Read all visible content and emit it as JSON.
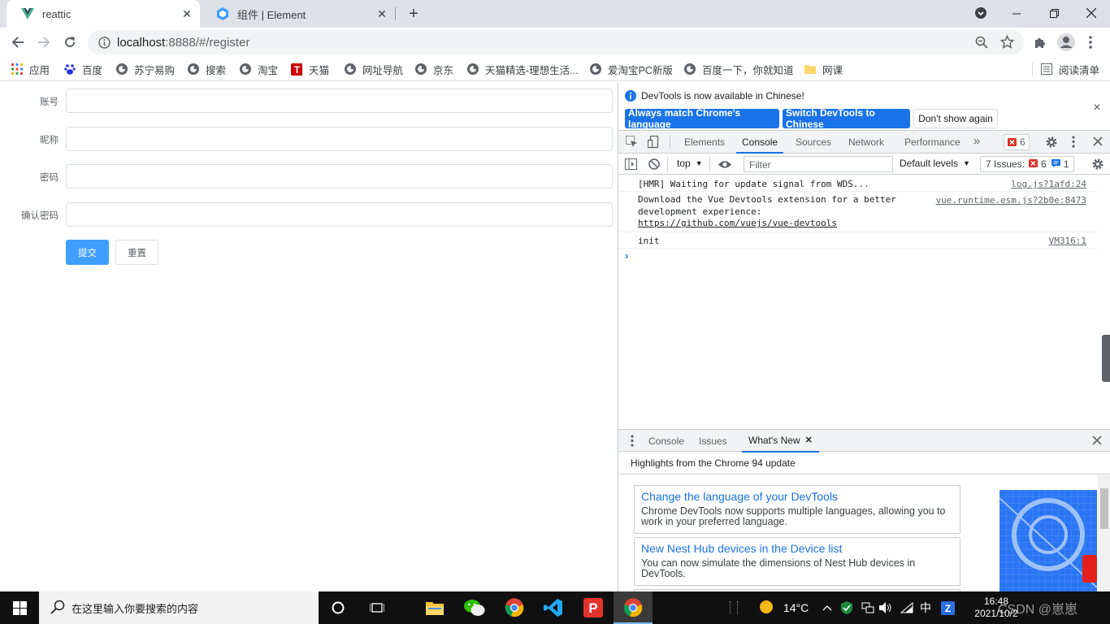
{
  "browser": {
    "tabs": [
      {
        "title": "reattic",
        "active": true,
        "icon": "vue-logo-icon"
      },
      {
        "title": "组件 | Element",
        "active": false,
        "icon": "element-logo-icon"
      }
    ],
    "new_tab_label": "+",
    "url_host": "localhost",
    "url_rest": ":8888/#/register",
    "bookmarks": [
      {
        "label": "应用",
        "icon": "apps-grid-icon"
      },
      {
        "label": "百度",
        "icon": "baidu-paw-icon"
      },
      {
        "label": "苏宁易购",
        "icon": "globe-icon"
      },
      {
        "label": "搜索",
        "icon": "globe-icon"
      },
      {
        "label": "淘宝",
        "icon": "globe-icon"
      },
      {
        "label": "天猫",
        "icon": "tmall-icon"
      },
      {
        "label": "网址导航",
        "icon": "globe-icon"
      },
      {
        "label": "京东",
        "icon": "globe-icon"
      },
      {
        "label": "天猫精选-理想生活...",
        "icon": "globe-icon"
      },
      {
        "label": "爱淘宝PC新版",
        "icon": "globe-icon"
      },
      {
        "label": "百度一下，你就知道",
        "icon": "globe-icon"
      },
      {
        "label": "网课",
        "icon": "folder-icon"
      }
    ],
    "reading_list": "阅读清单"
  },
  "form": {
    "fields": [
      {
        "label": "账号",
        "value": ""
      },
      {
        "label": "昵称",
        "value": ""
      },
      {
        "label": "密码",
        "value": ""
      },
      {
        "label": "确认密码",
        "value": ""
      }
    ],
    "submit_label": "提交",
    "reset_label": "重置"
  },
  "devtools": {
    "info_text": "DevTools is now available in Chinese!",
    "btn_match": "Always match Chrome's language",
    "btn_switch": "Switch DevTools to Chinese",
    "btn_dont_show": "Don't show again",
    "tabs": [
      "Elements",
      "Console",
      "Sources",
      "Network",
      "Performance"
    ],
    "active_tab": "Console",
    "error_count": "6",
    "context": "top",
    "filter_placeholder": "Filter",
    "levels": "Default levels",
    "issues_label": "7 Issues:",
    "issues_errors": "6",
    "issues_info": "1",
    "messages": [
      {
        "text": "[HMR] Waiting for update signal from WDS...",
        "source": "log.js?1afd:24"
      },
      {
        "text": "Download the Vue Devtools extension for a better\ndevelopment experience:\nhttps://github.com/vuejs/vue-devtools",
        "source": "vue.runtime.esm.js?2b0e:8473"
      },
      {
        "text": "init",
        "source": "VM316:1"
      }
    ],
    "prompt": "›",
    "drawer_tabs": [
      "Console",
      "Issues",
      "What's New"
    ],
    "drawer_active": "What's New",
    "whatsnew_heading": "Highlights from the Chrome 94 update",
    "cards": [
      {
        "title": "Change the language of your DevTools",
        "desc": "Chrome DevTools now supports multiple languages, allowing you to work in your preferred language."
      },
      {
        "title": "New Nest Hub devices in the Device list",
        "desc": "You can now simulate the dimensions of Nest Hub devices in DevTools."
      }
    ]
  },
  "taskbar": {
    "search_placeholder": "在这里输入你要搜索的内容",
    "weather": "14°C",
    "ime": "中",
    "time": "16:48",
    "date": "2021/10/2",
    "watermark": "CSDN @崽崽"
  },
  "colors": {
    "primary": "#409eff",
    "devtools_blue": "#1a73e8",
    "error_red": "#d93025"
  }
}
